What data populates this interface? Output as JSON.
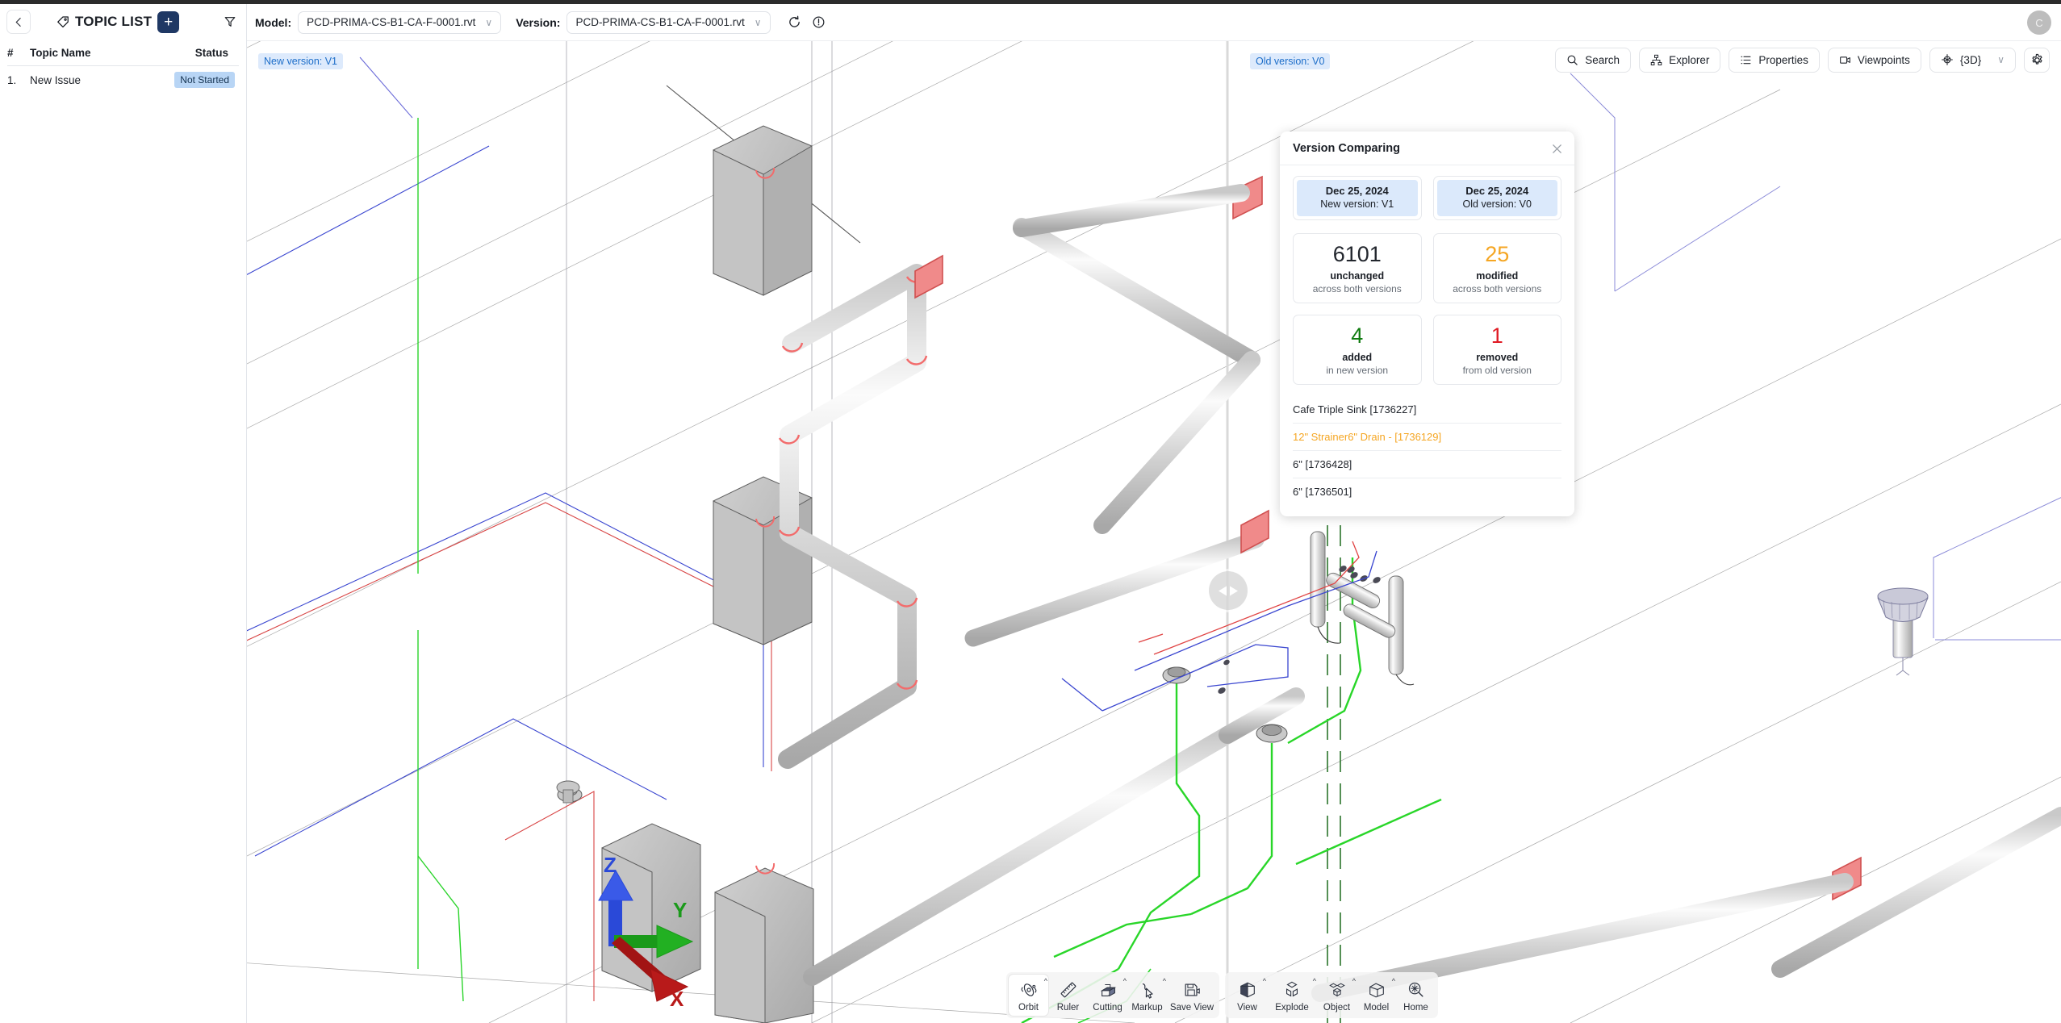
{
  "left_panel": {
    "back_icon": "chevron-left-icon",
    "tag_icon": "tag-icon",
    "title": "TOPIC LIST",
    "add_label": "+",
    "filter_icon": "filter-icon",
    "columns": {
      "num": "#",
      "name": "Topic Name",
      "status": "Status"
    },
    "rows": [
      {
        "num": "1.",
        "name": "New Issue",
        "status": "Not Started"
      }
    ]
  },
  "topbar": {
    "model_label": "Model:",
    "model_value": "PCD-PRIMA-CS-B1-CA-F-0001.rvt",
    "version_label": "Version:",
    "version_value": "PCD-PRIMA-CS-B1-CA-F-0001.rvt",
    "refresh_icon": "refresh-icon",
    "info_icon": "info-icon",
    "avatar_initial": "C"
  },
  "toolrow": {
    "buttons": [
      {
        "label": "Search",
        "icon": "search-icon"
      },
      {
        "label": "Explorer",
        "icon": "sitemap-icon"
      },
      {
        "label": "Properties",
        "icon": "list-icon"
      },
      {
        "label": "Viewpoints",
        "icon": "camera-icon"
      },
      {
        "label": "{3D}",
        "icon": "cube-axis-icon",
        "caret": "∨"
      }
    ],
    "settings_icon": "gear-icon"
  },
  "viewport": {
    "new_version_tag": "New version: V1",
    "old_version_tag": "Old version: V0",
    "split_handle_icon": "split-left-right-icon",
    "axis_labels": {
      "x": "X",
      "y": "Y",
      "z": "Z"
    },
    "axis_colors": {
      "x": "#c00000",
      "y": "#00a000",
      "z": "#2050e0"
    }
  },
  "version_comparing": {
    "title": "Version Comparing",
    "close_icon": "close-icon",
    "versions": [
      {
        "date": "Dec 25, 2024",
        "label": "New version: V1"
      },
      {
        "date": "Dec 25, 2024",
        "label": "Old version: V0"
      }
    ],
    "stats": [
      {
        "value": "6101",
        "label": "unchanged",
        "sub": "across both versions",
        "color": "#22262d"
      },
      {
        "value": "25",
        "label": "modified",
        "sub": "across both versions",
        "color": "#f5a623"
      },
      {
        "value": "4",
        "label": "added",
        "sub": "in new version",
        "color": "#107c10"
      },
      {
        "value": "1",
        "label": "removed",
        "sub": "from old version",
        "color": "#e01b24"
      }
    ],
    "items": [
      {
        "text": "Cafe Triple Sink [1736227]",
        "state": "normal"
      },
      {
        "text": "12\" Strainer6\" Drain - [1736129]",
        "state": "modified"
      },
      {
        "text": "6\" [1736428]",
        "state": "normal"
      },
      {
        "text": "6\" [1736501]",
        "state": "normal"
      }
    ]
  },
  "bottom_toolbar": {
    "group1": [
      {
        "label": "Orbit",
        "icon": "orbit-icon",
        "caret": "^",
        "active": true
      },
      {
        "label": "Ruler",
        "icon": "ruler-icon",
        "caret": ""
      },
      {
        "label": "Cutting",
        "icon": "cutting-box-icon",
        "caret": "^"
      },
      {
        "label": "Markup",
        "icon": "markup-cursor-icon",
        "caret": "^"
      },
      {
        "label": "Save View",
        "icon": "save-view-icon",
        "caret": ""
      }
    ],
    "group2": [
      {
        "label": "View",
        "icon": "view-cube-icon",
        "caret": "^"
      },
      {
        "label": "Explode",
        "icon": "explode-cube-icon",
        "caret": "^"
      },
      {
        "label": "Object",
        "icon": "object-cubes-icon",
        "caret": "^"
      },
      {
        "label": "Model",
        "icon": "model-cube-icon",
        "caret": "^"
      },
      {
        "label": "Home",
        "icon": "home-zoom-icon",
        "caret": ""
      }
    ]
  }
}
